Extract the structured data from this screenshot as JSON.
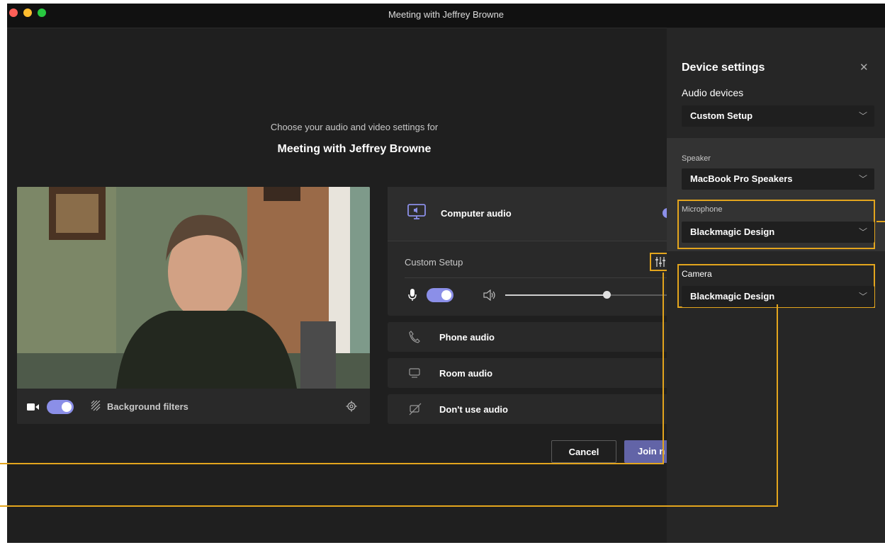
{
  "window": {
    "title": "Meeting with Jeffrey Browne",
    "traffic_colors": [
      "#ff5f57",
      "#febc2e",
      "#28c840"
    ]
  },
  "prejoin": {
    "subtitle": "Choose your audio and video settings for",
    "meeting_title": "Meeting with Jeffrey Browne"
  },
  "video": {
    "camera_on": true,
    "background_filters_label": "Background filters"
  },
  "audio": {
    "computer_audio_label": "Computer audio",
    "custom_setup_label": "Custom Setup",
    "mic_on": true,
    "phone_audio_label": "Phone audio",
    "room_audio_label": "Room audio",
    "no_audio_label": "Don't use audio"
  },
  "actions": {
    "cancel_label": "Cancel",
    "join_label": "Join n"
  },
  "device_settings": {
    "title": "Device settings",
    "close_glyph": "✕",
    "audio_devices_label": "Audio devices",
    "audio_devices_value": "Custom Setup",
    "speaker_label": "Speaker",
    "speaker_value": "MacBook Pro Speakers",
    "microphone_label": "Microphone",
    "microphone_value": "Blackmagic Design",
    "camera_label": "Camera",
    "camera_value": "Blackmagic Design"
  },
  "colors": {
    "accent": "#8b8fe8",
    "join_button": "#6264a7",
    "highlight": "#e3a51d"
  }
}
